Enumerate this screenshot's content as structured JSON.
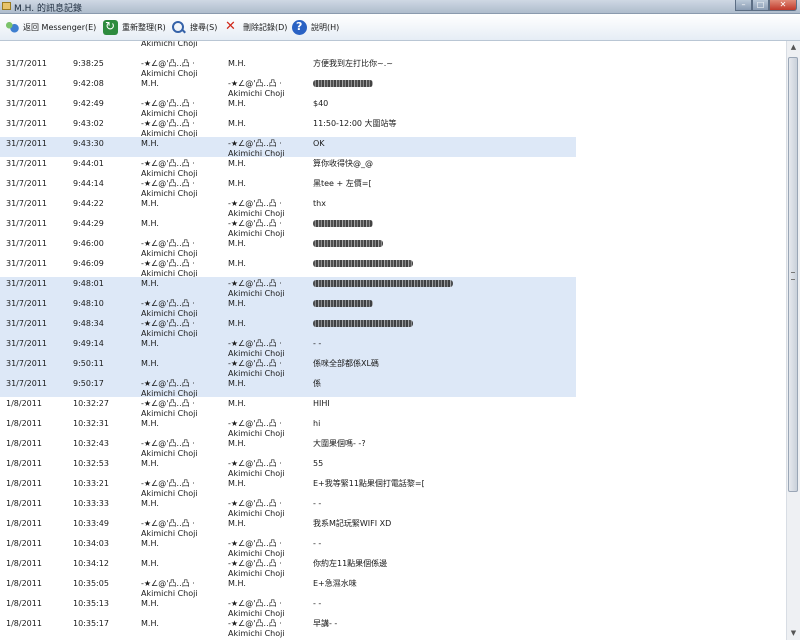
{
  "window": {
    "title": "M.H. 的訊息記錄"
  },
  "toolbar": {
    "back": "返回 Messenger(E)",
    "refresh": "重新整理(R)",
    "search": "搜尋(S)",
    "delete": "刪除記錄(D)",
    "help": "說明(H)"
  },
  "user_a": [
    "-★∠@'凸‥凸 ·",
    "Akimichi Choji"
  ],
  "user_b": "M.H.",
  "messages": [
    {
      "date": "",
      "time": "",
      "from": [
        "Akimichi Choji"
      ],
      "to": [],
      "text": "",
      "hl": false,
      "partial": true
    },
    {
      "date": "31/7/2011",
      "time": "9:38:25",
      "from": [
        "-★∠@'凸‥凸 ·",
        "Akimichi Choji"
      ],
      "to": [
        "M.H."
      ],
      "text": "方便我到左打比你~.~",
      "hl": false
    },
    {
      "date": "31/7/2011",
      "time": "9:42:08",
      "from": [
        "M.H."
      ],
      "to": [
        "-★∠@'凸‥凸 ·",
        "Akimichi Choji"
      ],
      "text": "",
      "redact": 60,
      "hl": false
    },
    {
      "date": "31/7/2011",
      "time": "9:42:49",
      "from": [
        "-★∠@'凸‥凸 ·",
        "Akimichi Choji"
      ],
      "to": [
        "M.H."
      ],
      "text": "$40",
      "hl": false
    },
    {
      "date": "31/7/2011",
      "time": "9:43:02",
      "from": [
        "-★∠@'凸‥凸 ·",
        "Akimichi Choji"
      ],
      "to": [
        "M.H."
      ],
      "text": "11:50-12:00 大圍站等",
      "hl": false
    },
    {
      "date": "31/7/2011",
      "time": "9:43:30",
      "from": [
        "M.H."
      ],
      "to": [
        "-★∠@'凸‥凸 ·",
        "Akimichi Choji"
      ],
      "text": "OK",
      "hl": true
    },
    {
      "date": "31/7/2011",
      "time": "9:44:01",
      "from": [
        "-★∠@'凸‥凸 ·",
        "Akimichi Choji"
      ],
      "to": [
        "M.H."
      ],
      "text": "算你收得快@_@",
      "hl": false
    },
    {
      "date": "31/7/2011",
      "time": "9:44:14",
      "from": [
        "-★∠@'凸‥凸 ·",
        "Akimichi Choji"
      ],
      "to": [
        "M.H."
      ],
      "text": "黑tee + 左價=[",
      "hl": false
    },
    {
      "date": "31/7/2011",
      "time": "9:44:22",
      "from": [
        "M.H."
      ],
      "to": [
        "-★∠@'凸‥凸 ·",
        "Akimichi Choji"
      ],
      "text": "thx",
      "hl": false
    },
    {
      "date": "31/7/2011",
      "time": "9:44:29",
      "from": [
        "M.H."
      ],
      "to": [
        "-★∠@'凸‥凸 ·",
        "Akimichi Choji"
      ],
      "text": "",
      "redact": 60,
      "hl": false
    },
    {
      "date": "31/7/2011",
      "time": "9:46:00",
      "from": [
        "-★∠@'凸‥凸 ·",
        "Akimichi Choji"
      ],
      "to": [
        "M.H."
      ],
      "text": "",
      "redact": 70,
      "hl": false
    },
    {
      "date": "31/7/2011",
      "time": "9:46:09",
      "from": [
        "-★∠@'凸‥凸 ·",
        "Akimichi Choji"
      ],
      "to": [
        "M.H."
      ],
      "text": "",
      "redact": 100,
      "hl": false
    },
    {
      "date": "31/7/2011",
      "time": "9:48:01",
      "from": [
        "M.H."
      ],
      "to": [
        "-★∠@'凸‥凸 ·",
        "Akimichi Choji"
      ],
      "text": "",
      "redact": 140,
      "hl": true
    },
    {
      "date": "31/7/2011",
      "time": "9:48:10",
      "from": [
        "-★∠@'凸‥凸 ·",
        "Akimichi Choji"
      ],
      "to": [
        "M.H."
      ],
      "text": "",
      "redact": 60,
      "hl": true
    },
    {
      "date": "31/7/2011",
      "time": "9:48:34",
      "from": [
        "-★∠@'凸‥凸 ·",
        "Akimichi Choji"
      ],
      "to": [
        "M.H."
      ],
      "text": "",
      "redact": 100,
      "hl": true
    },
    {
      "date": "31/7/2011",
      "time": "9:49:14",
      "from": [
        "M.H."
      ],
      "to": [
        "-★∠@'凸‥凸 ·",
        "Akimichi Choji"
      ],
      "text": "- -",
      "hl": true
    },
    {
      "date": "31/7/2011",
      "time": "9:50:11",
      "from": [
        "M.H."
      ],
      "to": [
        "-★∠@'凸‥凸 ·",
        "Akimichi Choji"
      ],
      "text": "係咪全部都係XL碼",
      "hl": true
    },
    {
      "date": "31/7/2011",
      "time": "9:50:17",
      "from": [
        "-★∠@'凸‥凸 ·",
        "Akimichi Choji"
      ],
      "to": [
        "M.H."
      ],
      "text": "係",
      "hl": true
    },
    {
      "date": "1/8/2011",
      "time": "10:32:27",
      "from": [
        "-★∠@'凸‥凸 ·",
        "Akimichi Choji"
      ],
      "to": [
        "M.H."
      ],
      "text": "HIHI",
      "hl": false
    },
    {
      "date": "1/8/2011",
      "time": "10:32:31",
      "from": [
        "M.H."
      ],
      "to": [
        "-★∠@'凸‥凸 ·",
        "Akimichi Choji"
      ],
      "text": "hi",
      "hl": false
    },
    {
      "date": "1/8/2011",
      "time": "10:32:43",
      "from": [
        "-★∠@'凸‥凸 ·",
        "Akimichi Choji"
      ],
      "to": [
        "M.H."
      ],
      "text": "大圍果個嗎- -?",
      "hl": false
    },
    {
      "date": "1/8/2011",
      "time": "10:32:53",
      "from": [
        "M.H."
      ],
      "to": [
        "-★∠@'凸‥凸 ·",
        "Akimichi Choji"
      ],
      "text": "55",
      "hl": false
    },
    {
      "date": "1/8/2011",
      "time": "10:33:21",
      "from": [
        "-★∠@'凸‥凸 ·",
        "Akimichi Choji"
      ],
      "to": [
        "M.H."
      ],
      "text": "E+我等緊11點果個打電話黎=[",
      "hl": false
    },
    {
      "date": "1/8/2011",
      "time": "10:33:33",
      "from": [
        "M.H."
      ],
      "to": [
        "-★∠@'凸‥凸 ·",
        "Akimichi Choji"
      ],
      "text": "- -",
      "hl": false
    },
    {
      "date": "1/8/2011",
      "time": "10:33:49",
      "from": [
        "-★∠@'凸‥凸 ·",
        "Akimichi Choji"
      ],
      "to": [
        "M.H."
      ],
      "text": "我系M記玩緊WIFI XD",
      "hl": false
    },
    {
      "date": "1/8/2011",
      "time": "10:34:03",
      "from": [
        "M.H."
      ],
      "to": [
        "-★∠@'凸‥凸 ·",
        "Akimichi Choji"
      ],
      "text": "- -",
      "hl": false
    },
    {
      "date": "1/8/2011",
      "time": "10:34:12",
      "from": [
        "M.H."
      ],
      "to": [
        "-★∠@'凸‥凸 ·",
        "Akimichi Choji"
      ],
      "text": "你約左11點果個係邊",
      "hl": false
    },
    {
      "date": "1/8/2011",
      "time": "10:35:05",
      "from": [
        "-★∠@'凸‥凸 ·",
        "Akimichi Choji"
      ],
      "to": [
        "M.H."
      ],
      "text": "E+急濕水味",
      "hl": false
    },
    {
      "date": "1/8/2011",
      "time": "10:35:13",
      "from": [
        "M.H."
      ],
      "to": [
        "-★∠@'凸‥凸 ·",
        "Akimichi Choji"
      ],
      "text": "- -",
      "hl": false
    },
    {
      "date": "1/8/2011",
      "time": "10:35:17",
      "from": [
        "M.H."
      ],
      "to": [
        "-★∠@'凸‥凸 ·",
        "Akimichi Choji"
      ],
      "text": "早講- -",
      "hl": false
    }
  ]
}
